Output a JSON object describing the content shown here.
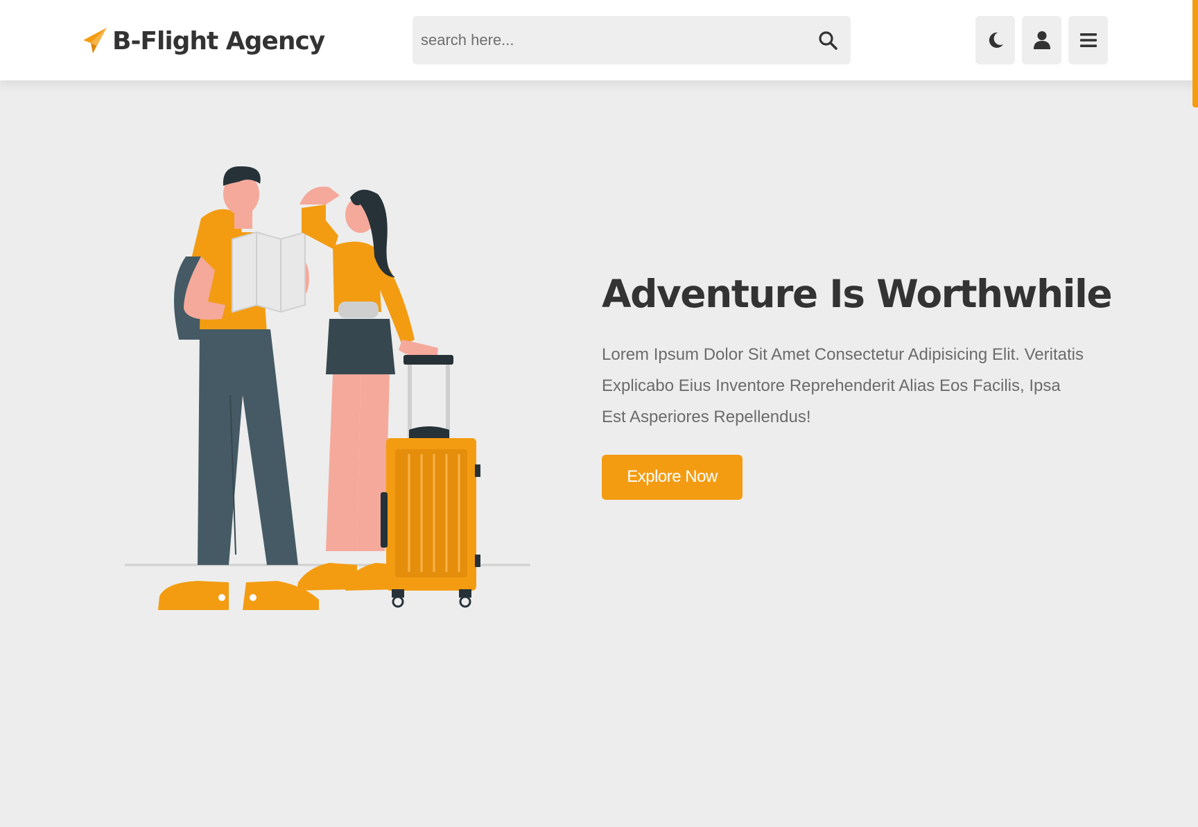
{
  "brand": {
    "name": "B-Flight Agency",
    "accent": "#f39c12",
    "text_color": "#333333"
  },
  "search": {
    "placeholder": "search here...",
    "icon": "search-icon"
  },
  "header_actions": [
    {
      "name": "theme-toggle",
      "icon": "moon-icon"
    },
    {
      "name": "account",
      "icon": "user-icon"
    },
    {
      "name": "menu",
      "icon": "hamburger-menu-icon"
    }
  ],
  "hero": {
    "title": "Adventure Is Worthwhile",
    "description": "Lorem Ipsum Dolor Sit Amet Consectetur Adipisicing Elit. Veritatis Explicabo Eius Inventore Reprehenderit Alias Eos Facilis, Ipsa Est Asperiores Repellendus!",
    "cta_label": "Explore Now",
    "illustration": "travelers-with-suitcase-illustration"
  },
  "colors": {
    "page_bg": "#ededed",
    "header_bg": "#ffffff",
    "button_bg": "#eeeeee"
  }
}
